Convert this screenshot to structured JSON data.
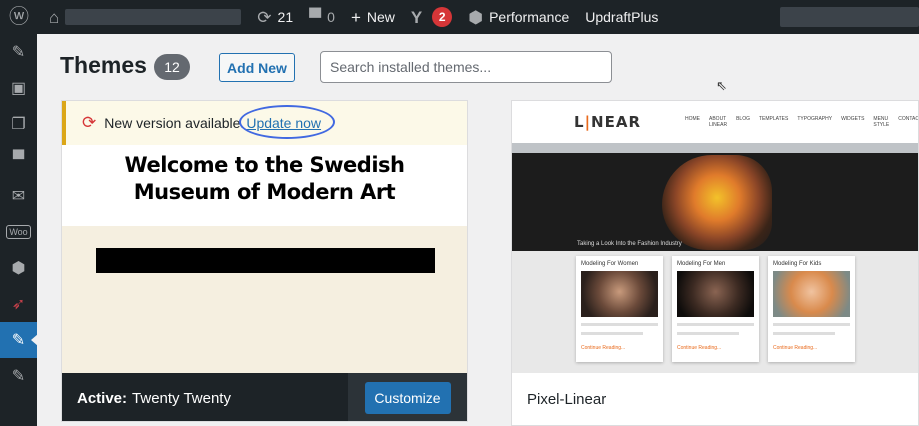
{
  "adminbar": {
    "update_count": "21",
    "comment_count": "0",
    "new_label": "New",
    "seo_badge": "2",
    "performance_label": "Performance",
    "updraft_label": "UpdraftPlus"
  },
  "sidebar": {
    "woo_label": "Woo"
  },
  "header": {
    "title": "Themes",
    "count": "12",
    "add_new_label": "Add New",
    "search_placeholder": "Search installed themes..."
  },
  "active_theme": {
    "notice_text": "New version available.",
    "update_link": "Update now",
    "preview_title_line1": "Welcome to the Swedish",
    "preview_title_line2": "Museum of Modern Art",
    "active_prefix": "Active:",
    "name": "Twenty Twenty",
    "customize_label": "Customize"
  },
  "second_theme": {
    "logo_prefix": "L",
    "logo_accent": "|",
    "logo_rest": "NEAR",
    "nav": [
      "HOME",
      "ABOUT LINEAR",
      "BLOG",
      "TEMPLATES",
      "TYPOGRAPHY",
      "WIDGETS",
      "MENU STYLE",
      "CONTACT"
    ],
    "caption": "Taking a Look Into the Fashion Industry",
    "thumbs": [
      {
        "title": "Modeling For Women"
      },
      {
        "title": "Modeling For Men"
      },
      {
        "title": "Modeling For Kids"
      }
    ],
    "read_more": "Continue Reading...",
    "name": "Pixel-Linear"
  },
  "colors": {
    "adminbar": "#1d2327",
    "accent": "#2271b1",
    "notice_border": "#dba617",
    "badge": "#d63638"
  }
}
